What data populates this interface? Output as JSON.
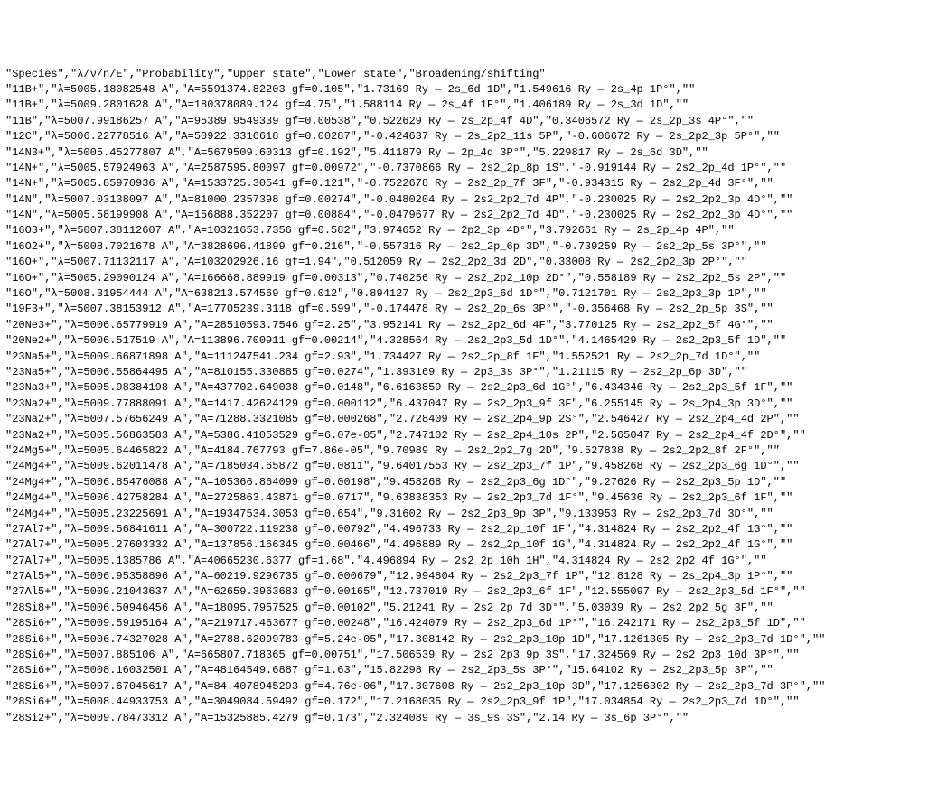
{
  "columns": [
    "Species",
    "λ/ν/n/E",
    "Probability",
    "Upper state",
    "Lower state",
    "Broadening/shifting"
  ],
  "rows": [
    [
      "11B+",
      "λ=5005.18082548 A",
      "A=5591374.82203 gf=0.105",
      "1.73169 Ry — 2s_6d 1D",
      "1.549616 Ry — 2s_4p 1P°",
      ""
    ],
    [
      "11B+",
      "λ=5009.2801628 A",
      "A=180378089.124 gf=4.75",
      "1.588114 Ry — 2s_4f 1F°",
      "1.406189 Ry — 2s_3d 1D",
      ""
    ],
    [
      "11B",
      "λ=5007.99186257 A",
      "A=95389.9549339 gf=0.00538",
      "0.522629 Ry — 2s_2p_4f 4D",
      "0.3406572 Ry — 2s_2p_3s 4P°",
      ""
    ],
    [
      "12C",
      "λ=5006.22778516 A",
      "A=50922.3316618 gf=0.00287",
      "-0.424637 Ry — 2s_2p2_11s 5P",
      "-0.606672 Ry — 2s_2p2_3p 5P°",
      ""
    ],
    [
      "14N3+",
      "λ=5005.45277807 A",
      "A=5679509.60313 gf=0.192",
      "5.411879 Ry — 2p_4d 3P°",
      "5.229817 Ry — 2s_6d 3D",
      ""
    ],
    [
      "14N+",
      "λ=5005.57924963 A",
      "A=2587595.80097 gf=0.00972",
      "-0.7370866 Ry — 2s2_2p_8p 1S",
      "-0.919144 Ry — 2s2_2p_4d 1P°",
      ""
    ],
    [
      "14N+",
      "λ=5005.85970936 A",
      "A=1533725.30541 gf=0.121",
      "-0.7522678 Ry — 2s2_2p_7f 3F",
      "-0.934315 Ry — 2s2_2p_4d 3F°",
      ""
    ],
    [
      "14N",
      "λ=5007.03138097 A",
      "A=81000.2357398 gf=0.00274",
      "-0.0480204 Ry — 2s2_2p2_7d 4P",
      "-0.230025 Ry — 2s2_2p2_3p 4D°",
      ""
    ],
    [
      "14N",
      "λ=5005.58199908 A",
      "A=156888.352207 gf=0.00884",
      "-0.0479677 Ry — 2s2_2p2_7d 4D",
      "-0.230025 Ry — 2s2_2p2_3p 4D°",
      ""
    ],
    [
      "16O3+",
      "λ=5007.38112607 A",
      "A=10321653.7356 gf=0.582",
      "3.974652 Ry — 2p2_3p 4D°",
      "3.792661 Ry — 2s_2p_4p 4P",
      ""
    ],
    [
      "16O2+",
      "λ=5008.7021678 A",
      "A=3828696.41899 gf=0.216",
      "-0.557316 Ry — 2s2_2p_6p 3D",
      "-0.739259 Ry — 2s2_2p_5s 3P°",
      ""
    ],
    [
      "16O+",
      "λ=5007.71132117 A",
      "A=103202926.16 gf=1.94",
      "0.512059 Ry — 2s2_2p2_3d 2D",
      "0.33008 Ry — 2s2_2p2_3p 2P°",
      ""
    ],
    [
      "16O+",
      "λ=5005.29090124 A",
      "A=166668.889919 gf=0.00313",
      "0.740256 Ry — 2s2_2p2_10p 2D°",
      "0.558189 Ry — 2s2_2p2_5s 2P",
      ""
    ],
    [
      "16O",
      "λ=5008.31954444 A",
      "A=638213.574569 gf=0.012",
      "0.894127 Ry — 2s2_2p3_6d 1D°",
      "0.7121701 Ry — 2s2_2p3_3p 1P",
      ""
    ],
    [
      "19F3+",
      "λ=5007.38153912 A",
      "A=17705239.3118 gf=0.599",
      "-0.174478 Ry — 2s2_2p_6s 3P°",
      "-0.356468 Ry — 2s2_2p_5p 3S",
      ""
    ],
    [
      "20Ne3+",
      "λ=5006.65779919 A",
      "A=28510593.7546 gf=2.25",
      "3.952141 Ry — 2s2_2p2_6d 4F",
      "3.770125 Ry — 2s2_2p2_5f 4G°",
      ""
    ],
    [
      "20Ne2+",
      "λ=5006.517519 A",
      "A=113896.700911 gf=0.00214",
      "4.328564 Ry — 2s2_2p3_5d 1D°",
      "4.1465429 Ry — 2s2_2p3_5f 1D",
      ""
    ],
    [
      "23Na5+",
      "λ=5009.66871898 A",
      "A=111247541.234 gf=2.93",
      "1.734427 Ry — 2s2_2p_8f 1F",
      "1.552521 Ry — 2s2_2p_7d 1D°",
      ""
    ],
    [
      "23Na5+",
      "λ=5006.55864495 A",
      "A=810155.330885 gf=0.0274",
      "1.393169 Ry — 2p3_3s 3P°",
      "1.21115 Ry — 2s2_2p_6p 3D",
      ""
    ],
    [
      "23Na3+",
      "λ=5005.98384198 A",
      "A=437702.649038 gf=0.0148",
      "6.6163859 Ry — 2s2_2p3_6d 1G°",
      "6.434346 Ry — 2s2_2p3_5f 1F",
      ""
    ],
    [
      "23Na2+",
      "λ=5009.77888091 A",
      "A=1417.42624129 gf=0.000112",
      "6.437047 Ry — 2s2_2p3_9f 3F",
      "6.255145 Ry — 2s_2p4_3p 3D°",
      ""
    ],
    [
      "23Na2+",
      "λ=5007.57656249 A",
      "A=71288.3321085 gf=0.000268",
      "2.728409 Ry — 2s2_2p4_9p 2S°",
      "2.546427 Ry — 2s2_2p4_4d 2P",
      ""
    ],
    [
      "23Na2+",
      "λ=5005.56863583 A",
      "A=5386.41053529 gf=6.07e-05",
      "2.747102 Ry — 2s2_2p4_10s 2P",
      "2.565047 Ry — 2s2_2p4_4f 2D°",
      ""
    ],
    [
      "24Mg5+",
      "λ=5005.64465822 A",
      "A=4184.767793 gf=7.86e-05",
      "9.70989 Ry — 2s2_2p2_7g 2D",
      "9.527838 Ry — 2s2_2p2_8f 2F°",
      ""
    ],
    [
      "24Mg4+",
      "λ=5009.62011478 A",
      "A=7185034.65872 gf=0.0811",
      "9.64017553 Ry — 2s2_2p3_7f 1P",
      "9.458268 Ry — 2s2_2p3_6g 1D°",
      ""
    ],
    [
      "24Mg4+",
      "λ=5006.85476088 A",
      "A=105366.864099 gf=0.00198",
      "9.458268 Ry — 2s2_2p3_6g 1D°",
      "9.27626 Ry — 2s2_2p3_5p 1D",
      ""
    ],
    [
      "24Mg4+",
      "λ=5006.42758284 A",
      "A=2725863.43871 gf=0.0717",
      "9.63838353 Ry — 2s2_2p3_7d 1F°",
      "9.45636 Ry — 2s2_2p3_6f 1F",
      ""
    ],
    [
      "24Mg4+",
      "λ=5005.23225691 A",
      "A=19347534.3053 gf=0.654",
      "9.31602 Ry — 2s2_2p3_9p 3P",
      "9.133953 Ry — 2s2_2p3_7d 3D°",
      ""
    ],
    [
      "27Al7+",
      "λ=5009.56841611 A",
      "A=300722.119238 gf=0.00792",
      "4.496733 Ry — 2s2_2p_10f 1F",
      "4.314824 Ry — 2s2_2p2_4f 1G°",
      ""
    ],
    [
      "27Al7+",
      "λ=5005.27603332 A",
      "A=137856.166345 gf=0.00466",
      "4.496889 Ry — 2s2_2p_10f 1G",
      "4.314824 Ry — 2s2_2p2_4f 1G°",
      ""
    ],
    [
      "27Al7+",
      "λ=5005.1385786 A",
      "A=40665230.6377 gf=1.68",
      "4.496894 Ry — 2s2_2p_10h 1H",
      "4.314824 Ry — 2s2_2p2_4f 1G°",
      ""
    ],
    [
      "27Al5+",
      "λ=5006.95358896 A",
      "A=60219.9296735 gf=0.000679",
      "12.994804 Ry — 2s2_2p3_7f 1P",
      "12.8128 Ry — 2s_2p4_3p 1P°",
      ""
    ],
    [
      "27Al5+",
      "λ=5009.21043637 A",
      "A=62659.3963683 gf=0.00165",
      "12.737019 Ry — 2s2_2p3_6f 1F",
      "12.555097 Ry — 2s2_2p3_5d 1F°",
      ""
    ],
    [
      "28Si8+",
      "λ=5006.50946456 A",
      "A=18095.7957525 gf=0.00102",
      "5.21241 Ry — 2s2_2p_7d 3D°",
      "5.03039 Ry — 2s2_2p2_5g 3F",
      ""
    ],
    [
      "28Si6+",
      "λ=5009.59195164 A",
      "A=219717.463677 gf=0.00248",
      "16.424079 Ry — 2s2_2p3_6d 1P°",
      "16.242171 Ry — 2s2_2p3_5f 1D",
      ""
    ],
    [
      "28Si6+",
      "λ=5006.74327028 A",
      "A=2788.62099783 gf=5.24e-05",
      "17.308142 Ry — 2s2_2p3_10p 1D",
      "17.1261305 Ry — 2s2_2p3_7d 1D°",
      ""
    ],
    [
      "28Si6+",
      "λ=5007.885106 A",
      "A=665807.718365 gf=0.00751",
      "17.506539 Ry — 2s2_2p3_9p 3S",
      "17.324569 Ry — 2s2_2p3_10d 3P°",
      ""
    ],
    [
      "28Si6+",
      "λ=5008.16032501 A",
      "A=48164549.6887 gf=1.63",
      "15.82298 Ry — 2s2_2p3_5s 3P°",
      "15.64102 Ry — 2s2_2p3_5p 3P",
      ""
    ],
    [
      "28Si6+",
      "λ=5007.67045617 A",
      "A=84.4078945293 gf=4.76e-06",
      "17.307608 Ry — 2s2_2p3_10p 3D",
      "17.1256302 Ry — 2s2_2p3_7d 3P°",
      ""
    ],
    [
      "28Si6+",
      "λ=5008.44933753 A",
      "A=3049084.59492 gf=0.172",
      "17.2168035 Ry — 2s2_2p3_9f 1P",
      "17.034854 Ry — 2s2_2p3_7d 1D°",
      ""
    ],
    [
      "28Si2+",
      "λ=5009.78473312 A",
      "A=15325885.4279 gf=0.173",
      "2.324089 Ry — 3s_9s 3S",
      "2.14 Ry — 3s_6p 3P°",
      ""
    ]
  ]
}
